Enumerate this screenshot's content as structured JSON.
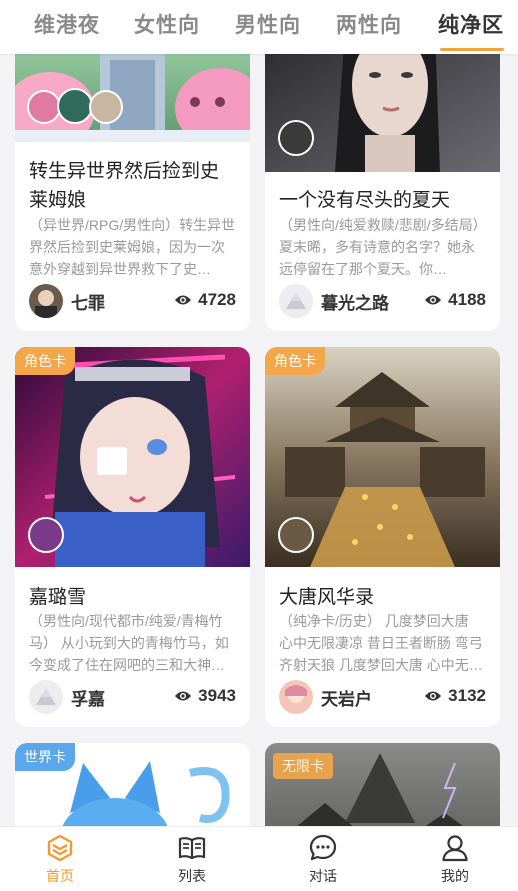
{
  "tabs": [
    {
      "label": "维港夜"
    },
    {
      "label": "女性向"
    },
    {
      "label": "男性向"
    },
    {
      "label": "两性向"
    },
    {
      "label": "纯净区"
    }
  ],
  "active_tab": "纯净区",
  "cards": [
    {
      "title": "转生异世界然后捡到史莱姆娘",
      "title_line1": "转生异世界然后捡到史",
      "title_line2": "莱姆娘",
      "desc": "（异世界/RPG/男性向）转生异世界然后捡到史莱姆娘，因为一次意外穿越到异世界救下了史…",
      "author": "七罪",
      "views": "4728",
      "badge": ""
    },
    {
      "title": "一个没有尽头的夏天",
      "desc": "（男性向/纯爱救赎/悲剧/多结局）夏末晞，多有诗意的名字？她永远停留在了那个夏天。你…",
      "author": "暮光之路",
      "views": "4188",
      "badge": ""
    },
    {
      "title": "嘉璐雪",
      "desc": "（男性向/现代都市/纯爱/青梅竹马） 从小玩到大的青梅竹马，如今变成了住在网吧的三和大神…",
      "author": "孚嘉",
      "views": "3943",
      "badge": "角色卡"
    },
    {
      "title": "大唐风华录",
      "desc": "（纯净卡/历史） 几度梦回大唐 心中无限凄凉 昔日王者断肠 弯弓齐射天狼 几度梦回大唐 心中无…",
      "author": "天岩户",
      "views": "3132",
      "badge": "角色卡"
    },
    {
      "badge": "世界卡"
    },
    {
      "badge": "无限卡"
    }
  ],
  "nav": [
    {
      "label": "首页",
      "icon": "home-cube-icon"
    },
    {
      "label": "列表",
      "icon": "book-icon"
    },
    {
      "label": "对话",
      "icon": "chat-bubble-icon"
    },
    {
      "label": "我的",
      "icon": "user-icon"
    }
  ],
  "colors": {
    "accent": "#f29a2e",
    "badge_role": "#f3a64a",
    "badge_world": "#5aa7ee",
    "text_main": "#222222",
    "text_muted": "#9a9a9a",
    "background": "#f3f3f5"
  }
}
